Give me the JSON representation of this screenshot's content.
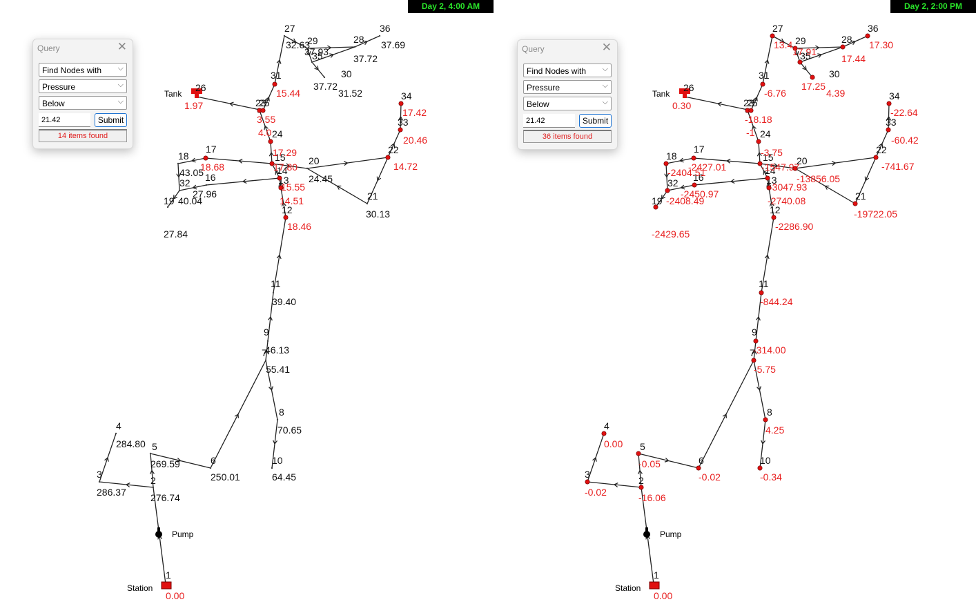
{
  "panels": [
    {
      "id": "left",
      "timestamp": "Day 2, 4:00 AM",
      "query": {
        "title": "Query",
        "find": "Find Nodes with",
        "parameter": "Pressure",
        "relation": "Below",
        "value": "21.42",
        "submit": "Submit",
        "status": "14 items found"
      },
      "labels": {
        "tank": "Tank",
        "pump": "Pump",
        "station": "Station"
      },
      "nodes": [
        {
          "id": "1",
          "value": "0.00",
          "low": true
        },
        {
          "id": "2",
          "value": "276.74",
          "low": false
        },
        {
          "id": "3",
          "value": "286.37",
          "low": false
        },
        {
          "id": "4",
          "value": "284.80",
          "low": false
        },
        {
          "id": "5",
          "value": "269.59",
          "low": false
        },
        {
          "id": "6",
          "value": "250.01",
          "low": false
        },
        {
          "id": "7",
          "value": "55.41",
          "low": false
        },
        {
          "id": "8",
          "value": "70.65",
          "low": false
        },
        {
          "id": "9",
          "value": "46.13",
          "low": false
        },
        {
          "id": "10",
          "value": "64.45",
          "low": false
        },
        {
          "id": "11",
          "value": "39.40",
          "low": false
        },
        {
          "id": "12",
          "value": "18.46",
          "low": true
        },
        {
          "id": "13",
          "value": "14.51",
          "low": true
        },
        {
          "id": "14",
          "value": "15.55",
          "low": true
        },
        {
          "id": "15",
          "value": "17.80",
          "low": true
        },
        {
          "id": "16",
          "value": "27.96",
          "low": false
        },
        {
          "id": "17",
          "value": "18.68",
          "low": true
        },
        {
          "id": "18",
          "value": "43.05",
          "low": false
        },
        {
          "id": "19",
          "value": "27.84",
          "low": false
        },
        {
          "id": "20",
          "value": "24.45",
          "low": false
        },
        {
          "id": "21",
          "value": "30.13",
          "low": false
        },
        {
          "id": "22",
          "value": "14.72",
          "low": true
        },
        {
          "id": "23",
          "value": "3.55",
          "low": true
        },
        {
          "id": "24",
          "value": "4.0",
          "low": true
        },
        {
          "id": "25",
          "value": "17.29",
          "low": true
        },
        {
          "id": "26",
          "value": "1.97",
          "low": true
        },
        {
          "id": "27",
          "value": "32.63",
          "low": false
        },
        {
          "id": "28",
          "value": "37.72",
          "low": false
        },
        {
          "id": "29",
          "value": "37.93",
          "low": false
        },
        {
          "id": "30",
          "value": "31.52",
          "low": false
        },
        {
          "id": "31",
          "value": "15.44",
          "low": true
        },
        {
          "id": "32",
          "value": "40.04",
          "low": false
        },
        {
          "id": "33",
          "value": "20.46",
          "low": true
        },
        {
          "id": "34",
          "value": "17.42",
          "low": true
        },
        {
          "id": "35",
          "value": "37.72",
          "low": false
        },
        {
          "id": "36",
          "value": "37.69",
          "low": false
        }
      ]
    },
    {
      "id": "right",
      "timestamp": "Day 2, 2:00 PM",
      "query": {
        "title": "Query",
        "find": "Find Nodes with",
        "parameter": "Pressure",
        "relation": "Below",
        "value": "21.42",
        "submit": "Submit",
        "status": "36 items found"
      },
      "labels": {
        "tank": "Tank",
        "pump": "Pump",
        "station": "Station"
      },
      "nodes": [
        {
          "id": "1",
          "value": "0.00",
          "low": true
        },
        {
          "id": "2",
          "value": "-16.06",
          "low": true
        },
        {
          "id": "3",
          "value": "-0.02",
          "low": true
        },
        {
          "id": "4",
          "value": "0.00",
          "low": true
        },
        {
          "id": "5",
          "value": "-0.05",
          "low": true
        },
        {
          "id": "6",
          "value": "-0.02",
          "low": true
        },
        {
          "id": "7",
          "value": "-5.75",
          "low": true
        },
        {
          "id": "8",
          "value": "4.25",
          "low": true
        },
        {
          "id": "9",
          "value": "-314.00",
          "low": true
        },
        {
          "id": "10",
          "value": "-0.34",
          "low": true
        },
        {
          "id": "11",
          "value": "-844.24",
          "low": true
        },
        {
          "id": "12",
          "value": "-2286.90",
          "low": true
        },
        {
          "id": "13",
          "value": "-2740.08",
          "low": true
        },
        {
          "id": "14",
          "value": "-3047.93",
          "low": true
        },
        {
          "id": "15",
          "value": "-1547.97",
          "low": true
        },
        {
          "id": "16",
          "value": "-2450.97",
          "low": true
        },
        {
          "id": "17",
          "value": "-2427.01",
          "low": true
        },
        {
          "id": "18",
          "value": "-2404.51",
          "low": true
        },
        {
          "id": "19",
          "value": "-2429.65",
          "low": true
        },
        {
          "id": "20",
          "value": "-13856.05",
          "low": true
        },
        {
          "id": "21",
          "value": "-19722.05",
          "low": true
        },
        {
          "id": "22",
          "value": "-741.67",
          "low": true
        },
        {
          "id": "23",
          "value": "-18.18",
          "low": true
        },
        {
          "id": "24",
          "value": "-1",
          "low": true
        },
        {
          "id": "25",
          "value": "-3.75",
          "low": true
        },
        {
          "id": "26",
          "value": "0.30",
          "low": true
        },
        {
          "id": "27",
          "value": "13.4",
          "low": true
        },
        {
          "id": "28",
          "value": "17.44",
          "low": true
        },
        {
          "id": "29",
          "value": "17.91",
          "low": true
        },
        {
          "id": "30",
          "value": "4.39",
          "low": true
        },
        {
          "id": "31",
          "value": "-6.76",
          "low": true
        },
        {
          "id": "32",
          "value": "-2408.49",
          "low": true
        },
        {
          "id": "33",
          "value": "-60.42",
          "low": true
        },
        {
          "id": "34",
          "value": "-22.64",
          "low": true
        },
        {
          "id": "35",
          "value": "17.25",
          "low": true
        },
        {
          "id": "36",
          "value": "17.30",
          "low": true
        }
      ]
    }
  ]
}
